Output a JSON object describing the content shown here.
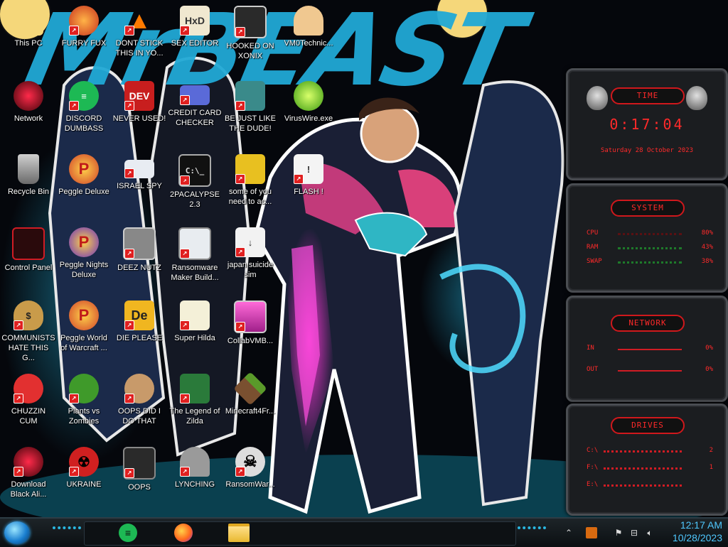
{
  "wallpaper": {
    "title_text": "MrBEAST",
    "accent": "#21a9d6"
  },
  "desktop": {
    "icons": [
      {
        "label": "This PC"
      },
      {
        "label": "FURRY FUX"
      },
      {
        "label": "DONT STICK THIS IN YO..."
      },
      {
        "label": "SEX EDITOR"
      },
      {
        "label": "HOOKED ON XONIX"
      },
      {
        "label": "VM0Technic..."
      },
      {
        "label": "Network"
      },
      {
        "label": "DISCORD DUMBASS"
      },
      {
        "label": "NEVER USED!"
      },
      {
        "label": "CREDIT CARD CHECKER"
      },
      {
        "label": "BE JUST LIKE THE DUDE!"
      },
      {
        "label": "VirusWire.exe"
      },
      {
        "label": "Recycle Bin"
      },
      {
        "label": "Peggle Deluxe"
      },
      {
        "label": "ISRAEL SPY"
      },
      {
        "label": "2PACALYPSE 2.3"
      },
      {
        "label": "some of you need to ac..."
      },
      {
        "label": "FLASH !"
      },
      {
        "label": "Control Panel"
      },
      {
        "label": "Peggle Nights Deluxe"
      },
      {
        "label": "DEEZ NUTZ"
      },
      {
        "label": "Ransomware Maker Build..."
      },
      {
        "label": "japan suicide sim"
      },
      {
        "label": "COMMUNISTS HATE THIS G..."
      },
      {
        "label": "Peggle World of Warcraft ..."
      },
      {
        "label": "DIE PLEASE"
      },
      {
        "label": "Super Hilda"
      },
      {
        "label": "CollabVMB..."
      },
      {
        "label": "CHUZZIN CUM"
      },
      {
        "label": "Plants vs Zombies"
      },
      {
        "label": "OOPS DID I DO THAT"
      },
      {
        "label": "The Legend of Zilda"
      },
      {
        "label": "Minecraft4Fr..."
      },
      {
        "label": "Download Black Ali..."
      },
      {
        "label": "UKRAINE"
      },
      {
        "label": "OOPS"
      },
      {
        "label": "LYNCHING"
      },
      {
        "label": "RansomWar..."
      }
    ]
  },
  "gadgets": {
    "time": {
      "title": "TIME",
      "clock": "0:17:04",
      "date": "Saturday 28 October 2023"
    },
    "system": {
      "title": "SYSTEM",
      "rows": [
        {
          "key": "CPU",
          "value": "80%"
        },
        {
          "key": "RAM",
          "value": "43%"
        },
        {
          "key": "SWAP",
          "value": "38%"
        }
      ]
    },
    "network": {
      "title": "NETWORK",
      "rows": [
        {
          "key": "IN",
          "value": "0%"
        },
        {
          "key": "OUT",
          "value": "0%"
        }
      ]
    },
    "drives": {
      "title": "DRIVES",
      "rows": [
        {
          "key": "C:\\",
          "value": "2"
        },
        {
          "key": "F:\\",
          "value": "1"
        },
        {
          "key": "E:\\",
          "value": ""
        }
      ]
    }
  },
  "taskbar": {
    "pinned": [
      {
        "name": "spotify"
      },
      {
        "name": "firefox"
      },
      {
        "name": "file-explorer"
      }
    ],
    "clock": {
      "time": "12:17 AM",
      "date": "10/28/2023"
    }
  }
}
